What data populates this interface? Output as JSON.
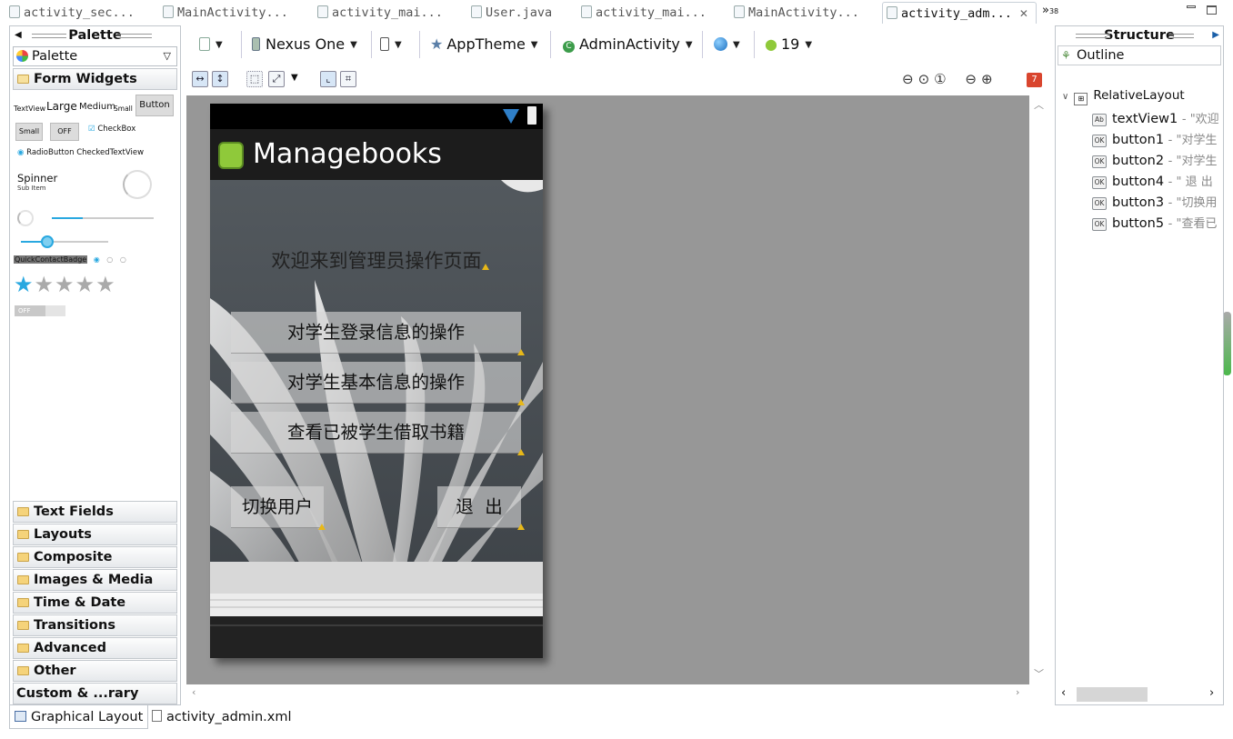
{
  "editor_tabs": [
    {
      "label": "activity_sec..."
    },
    {
      "label": "MainActivity..."
    },
    {
      "label": "activity_mai..."
    },
    {
      "label": "User.java"
    },
    {
      "label": "activity_mai..."
    },
    {
      "label": "MainActivity..."
    },
    {
      "label": "activity_adm...",
      "active": true
    }
  ],
  "tab_overflow": {
    "arrow": "»",
    "count": "38"
  },
  "palette": {
    "title": "Palette",
    "selector": "Palette",
    "open_category": "Form Widgets",
    "widgets": {
      "textview": "TextView",
      "large": "Large",
      "medium": "Medium",
      "small_text": "Small",
      "button": "Button",
      "small_button": "Small",
      "toggle_off": "OFF",
      "checkbox": "CheckBox",
      "radiobutton": "RadioButton",
      "checkedtextview": "CheckedTextView",
      "spinner": "Spinner",
      "spinner_sub": "Sub Item",
      "quickcontactbadge": "QuickContactBadge",
      "switch_off": "OFF"
    },
    "categories": [
      "Text Fields",
      "Layouts",
      "Composite",
      "Images & Media",
      "Time & Date",
      "Transitions",
      "Advanced",
      "Other",
      "Custom & ...rary Views"
    ]
  },
  "toolbar": {
    "device": "Nexus One",
    "theme": "AppTheme",
    "activity": "AdminActivity",
    "api_level": "19",
    "error_count": "7"
  },
  "phone": {
    "app_title": "Managebooks",
    "welcome": "欢迎来到管理员操作页面",
    "button1": "对学生登录信息的操作",
    "button2": "对学生基本信息的操作",
    "button5": "查看已被学生借取书籍",
    "button3": "切换用户",
    "button4": "退  出"
  },
  "structure": {
    "title": "Structure",
    "outline": "Outline",
    "root": "RelativeLayout",
    "nodes": [
      {
        "id": "textView1",
        "text": "- \"欢迎",
        "icon": "Ab"
      },
      {
        "id": "button1",
        "text": "- \"对学生",
        "icon": "OK"
      },
      {
        "id": "button2",
        "text": "- \"对学生",
        "icon": "OK"
      },
      {
        "id": "button4",
        "text": "- \" 退 出",
        "icon": "OK"
      },
      {
        "id": "button3",
        "text": "- \"切换用",
        "icon": "OK"
      },
      {
        "id": "button5",
        "text": "- \"查看已",
        "icon": "OK"
      }
    ]
  },
  "bottom_tabs": [
    "Graphical Layout",
    "activity_admin.xml"
  ],
  "colors": {
    "accent": "#29a8e0",
    "canvas": "#979797",
    "warning": "#e8b818",
    "android_green": "#8fc93a"
  }
}
